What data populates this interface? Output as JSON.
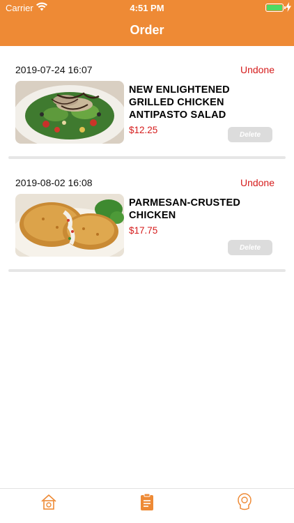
{
  "status_bar": {
    "carrier": "Carrier",
    "time": "4:51 PM"
  },
  "header": {
    "title": "Order",
    "background_color": "#ee8a35"
  },
  "orders": [
    {
      "date": "2019-07-24 16:07",
      "status": "Undone",
      "name": "NEW ENLIGHTENED GRILLED CHICKEN ANTIPASTO SALAD",
      "price": "$12.25",
      "delete_label": "Delete",
      "image": "salad-image"
    },
    {
      "date": "2019-08-02 16:08",
      "status": "Undone",
      "name": "PARMESAN-CRUSTED CHICKEN",
      "price": "$17.75",
      "delete_label": "Delete",
      "image": "fried-chicken-image"
    }
  ],
  "tabbar": {
    "items": [
      {
        "icon": "home-icon",
        "active": false
      },
      {
        "icon": "clipboard-icon",
        "active": true
      },
      {
        "icon": "profile-icon",
        "active": false
      }
    ],
    "active_color": "#ee8a35"
  },
  "colors": {
    "accent": "#ee8a35",
    "status_red": "#d51b1b",
    "delete_bg": "#dcdcdc"
  }
}
